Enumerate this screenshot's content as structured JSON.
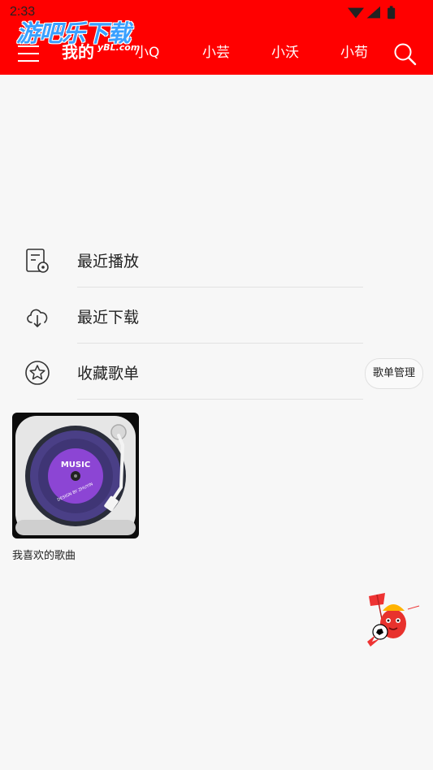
{
  "status_bar": {
    "time": "2:33"
  },
  "watermark": {
    "main": "游吧乐下载",
    "sub": "yBL.com"
  },
  "header": {
    "tabs": [
      {
        "label": "我的",
        "active": true
      },
      {
        "label": "小Q",
        "active": false
      },
      {
        "label": "小芸",
        "active": false
      },
      {
        "label": "小沃",
        "active": false
      },
      {
        "label": "小苟",
        "active": false
      }
    ]
  },
  "menu": {
    "items": [
      {
        "label": "最近播放",
        "icon": "recent-play-icon"
      },
      {
        "label": "最近下载",
        "icon": "cloud-download-icon"
      },
      {
        "label": "收藏歌单",
        "icon": "star-icon"
      }
    ],
    "manage_label": "歌单管理"
  },
  "playlists": [
    {
      "name": "我喜欢的歌曲",
      "cover_text": "MUSIC",
      "cover_subtext": "DESIGN BY ZHUYIN"
    }
  ],
  "colors": {
    "header": "#ff0000",
    "background": "#f7f7f7",
    "cover_disc": "#6b3fb3"
  }
}
